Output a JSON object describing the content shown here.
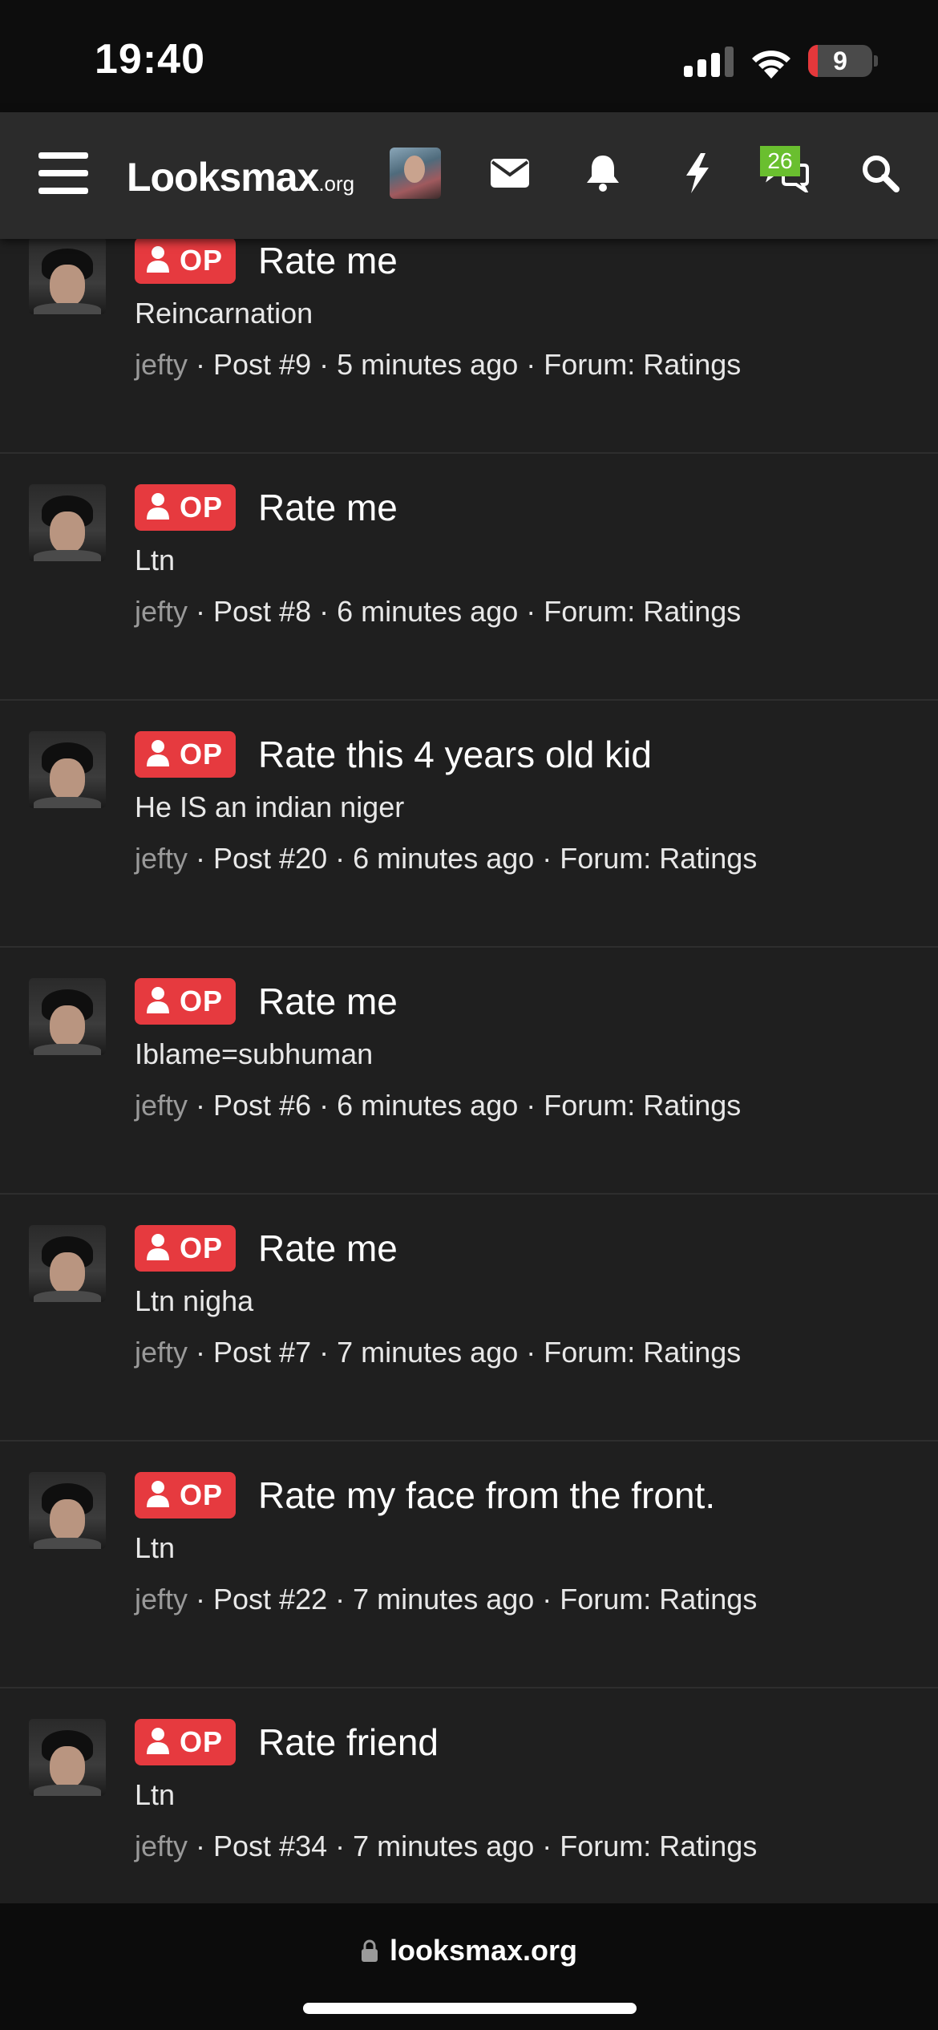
{
  "status_bar": {
    "time": "19:40",
    "battery": "9",
    "icons": [
      "signal-icon",
      "wifi-icon",
      "battery-icon"
    ]
  },
  "header": {
    "brand": "Looksmax",
    "brand_suffix": ".org",
    "messages_badge": "26",
    "icons": [
      "menu-icon",
      "avatar",
      "envelope-icon",
      "bell-icon",
      "lightning-icon",
      "conversations-icon",
      "search-icon"
    ]
  },
  "colors": {
    "op_badge": "#e63a3f",
    "badge_green": "#6abf2f",
    "background": "#1f1f1f",
    "header": "#2b2b2b"
  },
  "posts": [
    {
      "badge": "OP",
      "title": "Rate me",
      "snippet": "Reincarnation",
      "author": "jefty",
      "meta": " · Post #9 · 5 minutes ago · Forum: Ratings"
    },
    {
      "badge": "OP",
      "title": "Rate me",
      "snippet": "Ltn",
      "author": "jefty",
      "meta": " · Post #8 · 6 minutes ago · Forum: Ratings"
    },
    {
      "badge": "OP",
      "title": "Rate this 4 years old kid",
      "snippet": "He IS an indian niger",
      "author": "jefty",
      "meta": " · Post #20 · 6 minutes ago · Forum: Ratings"
    },
    {
      "badge": "OP",
      "title": "Rate me",
      "snippet": "Iblame=subhuman",
      "author": "jefty",
      "meta": " · Post #6 · 6 minutes ago · Forum: Ratings"
    },
    {
      "badge": "OP",
      "title": "Rate me",
      "snippet": "Ltn nigha",
      "author": "jefty",
      "meta": " · Post #7 · 7 minutes ago · Forum: Ratings"
    },
    {
      "badge": "OP",
      "title": "Rate my face from the front.",
      "snippet": "Ltn",
      "author": "jefty",
      "meta": " · Post #22 · 7 minutes ago · Forum: Ratings"
    },
    {
      "badge": "OP",
      "title": "Rate friend",
      "snippet": "Ltn",
      "author": "jefty",
      "meta": " · Post #34 · 7 minutes ago · Forum: Ratings"
    }
  ],
  "url_bar": {
    "url": "looksmax.org"
  }
}
